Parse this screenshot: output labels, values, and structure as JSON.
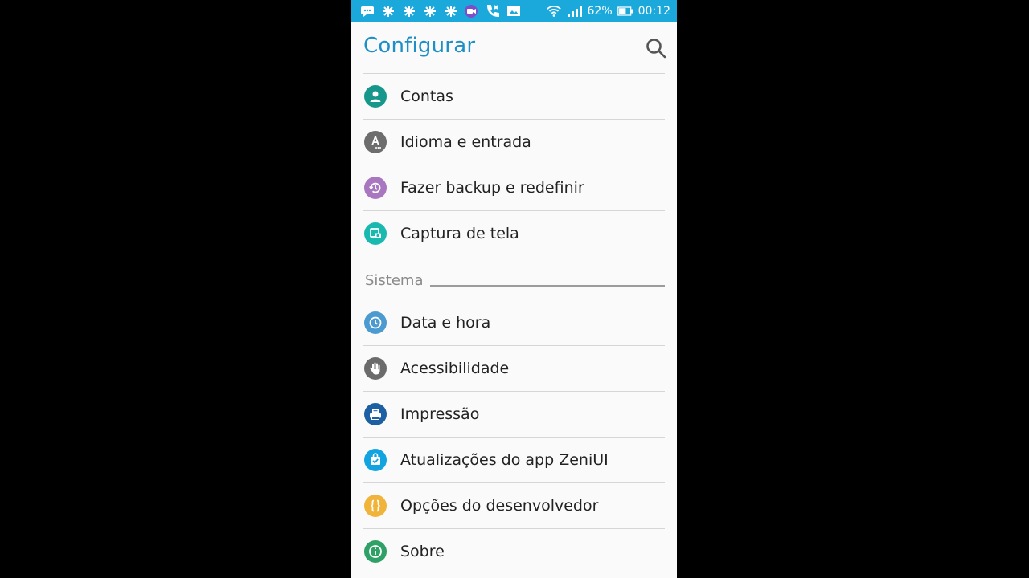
{
  "status_bar": {
    "battery_percent": "62%",
    "time": "00:12",
    "icons": [
      "message-icon",
      "pinwheel-icon",
      "pinwheel-icon",
      "pinwheel-icon",
      "pinwheel-icon",
      "video-call-icon",
      "missed-call-icon",
      "image-icon",
      "wifi-icon",
      "signal-icon",
      "battery-icon"
    ]
  },
  "header": {
    "title": "Configurar",
    "search_icon": "search-icon"
  },
  "items_top": [
    {
      "label": "Contas",
      "icon": "account-icon",
      "color": "#17978c"
    },
    {
      "label": "Idioma e entrada",
      "icon": "language-icon",
      "color": "#6d6d6d"
    },
    {
      "label": "Fazer backup e redefinir",
      "icon": "backup-icon",
      "color": "#a877c0"
    },
    {
      "label": "Captura de tela",
      "icon": "screenshot-icon",
      "color": "#19b9b0"
    }
  ],
  "section": {
    "title": "Sistema"
  },
  "items_system": [
    {
      "label": "Data e hora",
      "icon": "clock-icon",
      "color": "#4b9bd0"
    },
    {
      "label": "Acessibilidade",
      "icon": "hand-icon",
      "color": "#6b6b6b"
    },
    {
      "label": "Impressão",
      "icon": "printer-icon",
      "color": "#1d5fa3"
    },
    {
      "label": "Atualizações do app ZeniUI",
      "icon": "update-icon",
      "color": "#12a4e0"
    },
    {
      "label": "Opções do desenvolvedor",
      "icon": "developer-icon",
      "color": "#f1b43a"
    },
    {
      "label": "Sobre",
      "icon": "info-icon",
      "color": "#2fa066"
    }
  ]
}
